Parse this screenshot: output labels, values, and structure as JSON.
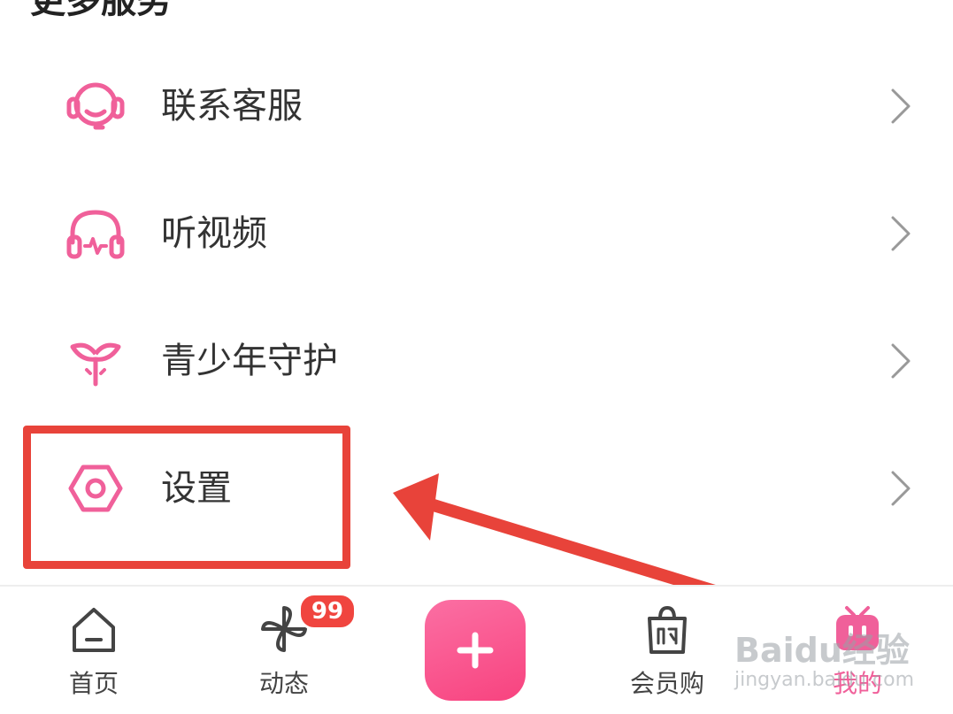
{
  "section": {
    "title": "更多服务"
  },
  "menu": {
    "items": [
      {
        "label": "联系客服",
        "icon": "headset-icon"
      },
      {
        "label": "听视频",
        "icon": "headphones-icon"
      },
      {
        "label": "青少年守护",
        "icon": "sprout-icon"
      },
      {
        "label": "设置",
        "icon": "gear-icon"
      }
    ]
  },
  "tabs": [
    {
      "label": "首页",
      "icon": "home-icon"
    },
    {
      "label": "动态",
      "icon": "pinwheel-icon"
    },
    {
      "label": "会员购",
      "icon": "shopping-bag-icon"
    },
    {
      "label": "我的",
      "icon": "tv-mascot-icon"
    }
  ],
  "badge": {
    "count": "99"
  },
  "watermark": {
    "brand": "Baidu经验",
    "url": "jingyan.baidu.com"
  },
  "colors": {
    "accent": "#f0609a",
    "highlight": "#e8433a",
    "badge": "#f0453f"
  }
}
